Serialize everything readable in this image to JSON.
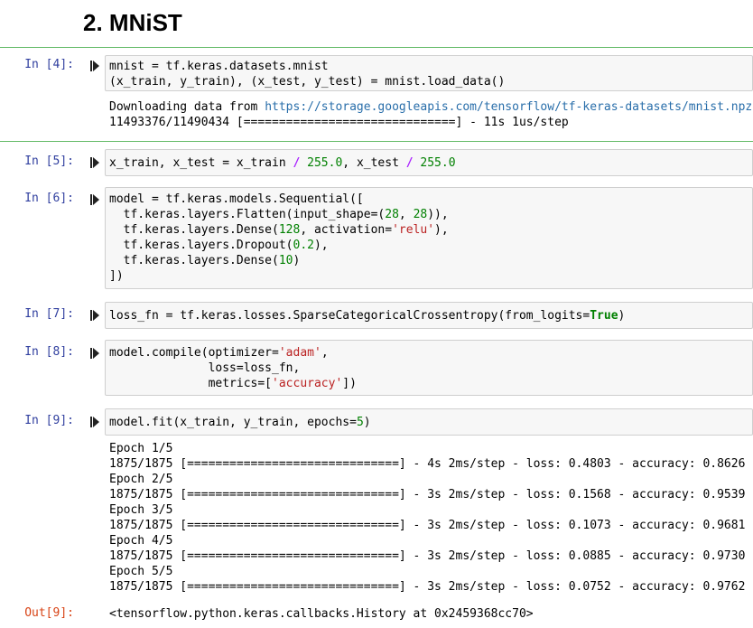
{
  "heading": "2. MNiST",
  "cells": [
    {
      "prompt": "In [4]:",
      "code": [
        "mnist = tf.keras.datasets.mnist",
        "(x_train, y_train), (x_test, y_test) = mnist.load_data()"
      ],
      "output": [
        {
          "prefix": "Downloading data from ",
          "link": "https://storage.googleapis.com/tensorflow/tf-keras-datasets/mnist.npz"
        },
        {
          "text": "11493376/11490434 [==============================] - 11s 1us/step"
        }
      ]
    },
    {
      "prompt": "In [5]:",
      "code": [
        "x_train, x_test = x_train / 255.0, x_test / 255.0"
      ]
    },
    {
      "prompt": "In [6]:",
      "code": [
        "model = tf.keras.models.Sequential([",
        "  tf.keras.layers.Flatten(input_shape=(28, 28)),",
        "  tf.keras.layers.Dense(128, activation='relu'),",
        "  tf.keras.layers.Dropout(0.2),",
        "  tf.keras.layers.Dense(10)",
        "])"
      ]
    },
    {
      "prompt": "In [7]:",
      "code": [
        "loss_fn = tf.keras.losses.SparseCategoricalCrossentropy(from_logits=True)"
      ]
    },
    {
      "prompt": "In [8]:",
      "code": [
        "model.compile(optimizer='adam',",
        "              loss=loss_fn,",
        "              metrics=['accuracy'])"
      ]
    },
    {
      "prompt": "In [9]:",
      "code": [
        "model.fit(x_train, y_train, epochs=5)"
      ],
      "output": [
        {
          "text": "Epoch 1/5"
        },
        {
          "text": "1875/1875 [==============================] - 4s 2ms/step - loss: 0.4803 - accuracy: 0.8626"
        },
        {
          "text": "Epoch 2/5"
        },
        {
          "text": "1875/1875 [==============================] - 3s 2ms/step - loss: 0.1568 - accuracy: 0.9539"
        },
        {
          "text": "Epoch 3/5"
        },
        {
          "text": "1875/1875 [==============================] - 3s 2ms/step - loss: 0.1073 - accuracy: 0.9681"
        },
        {
          "text": "Epoch 4/5"
        },
        {
          "text": "1875/1875 [==============================] - 3s 2ms/step - loss: 0.0885 - accuracy: 0.9730"
        },
        {
          "text": "Epoch 5/5"
        },
        {
          "text": "1875/1875 [==============================] - 3s 2ms/step - loss: 0.0752 - accuracy: 0.9762"
        }
      ],
      "out_prompt": "Out[9]:",
      "result": "<tensorflow.python.keras.callbacks.History at 0x2459368cc70>"
    }
  ],
  "colors": {
    "prompt_in": "#303f9f",
    "prompt_out": "#d84315",
    "cell_rule": "#66bb6a"
  },
  "icons": {
    "run": "run-cell-icon"
  }
}
